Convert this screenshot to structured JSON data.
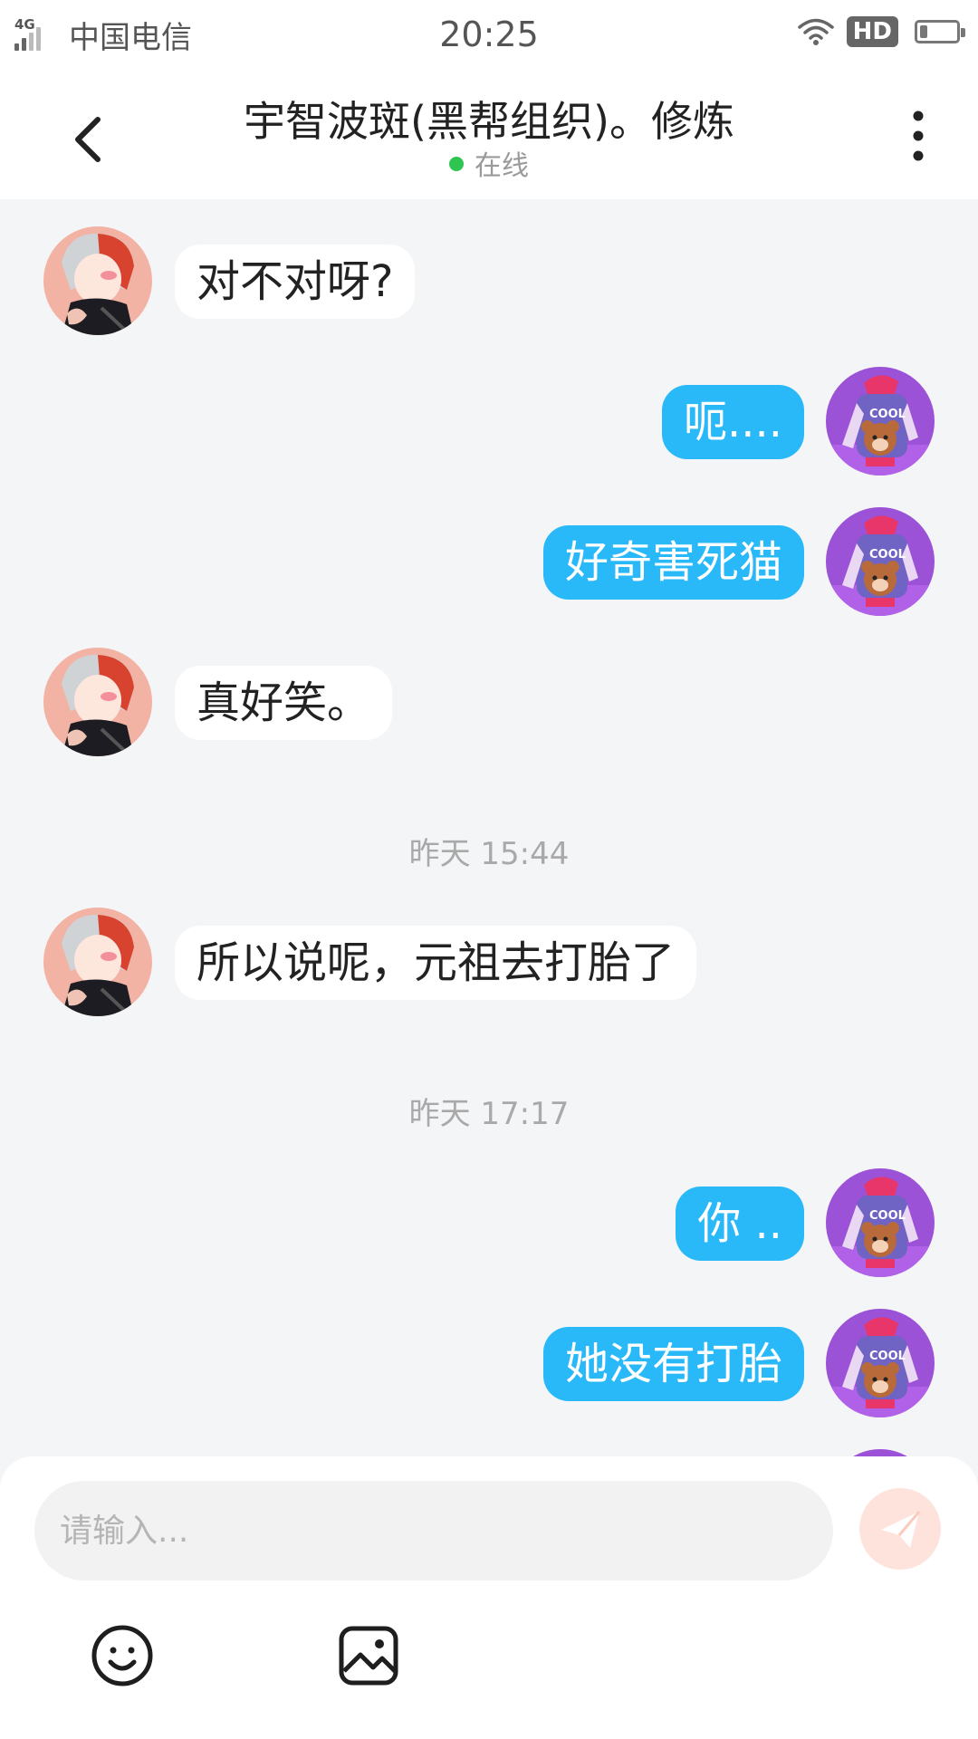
{
  "status_bar": {
    "network": "4G",
    "carrier": "中国电信",
    "time": "20:25",
    "hd_label": "HD",
    "icons": [
      "signal-icon",
      "wifi-icon",
      "hd-icon",
      "battery-icon"
    ]
  },
  "header": {
    "title": "宇智波斑(黑帮组织)。修炼",
    "status": "在线",
    "status_color": "#2fc550",
    "icons": [
      "back-arrow-icon",
      "more-vertical-icon"
    ]
  },
  "messages": [
    {
      "from": "other",
      "text": "对不对呀?"
    },
    {
      "from": "me",
      "text": "呃...."
    },
    {
      "from": "me",
      "text": "好奇害死猫"
    },
    {
      "from": "other",
      "text": "真好笑。"
    },
    {
      "type": "time",
      "text": "昨天 15:44"
    },
    {
      "from": "other",
      "text": "所以说呢，元祖去打胎了"
    },
    {
      "type": "time",
      "text": "昨天 17:17"
    },
    {
      "from": "me",
      "text": "你 .."
    },
    {
      "from": "me",
      "text": "她没有打胎"
    }
  ],
  "input": {
    "placeholder": "请输入...",
    "value": ""
  },
  "toolbar": {
    "icons": [
      "send-icon",
      "emoji-icon",
      "image-icon"
    ]
  },
  "colors": {
    "outgoing_bubble": "#29b8f8",
    "incoming_bubble": "#ffffff",
    "background": "#f4f5f7",
    "send_button": "#fde3dc"
  }
}
